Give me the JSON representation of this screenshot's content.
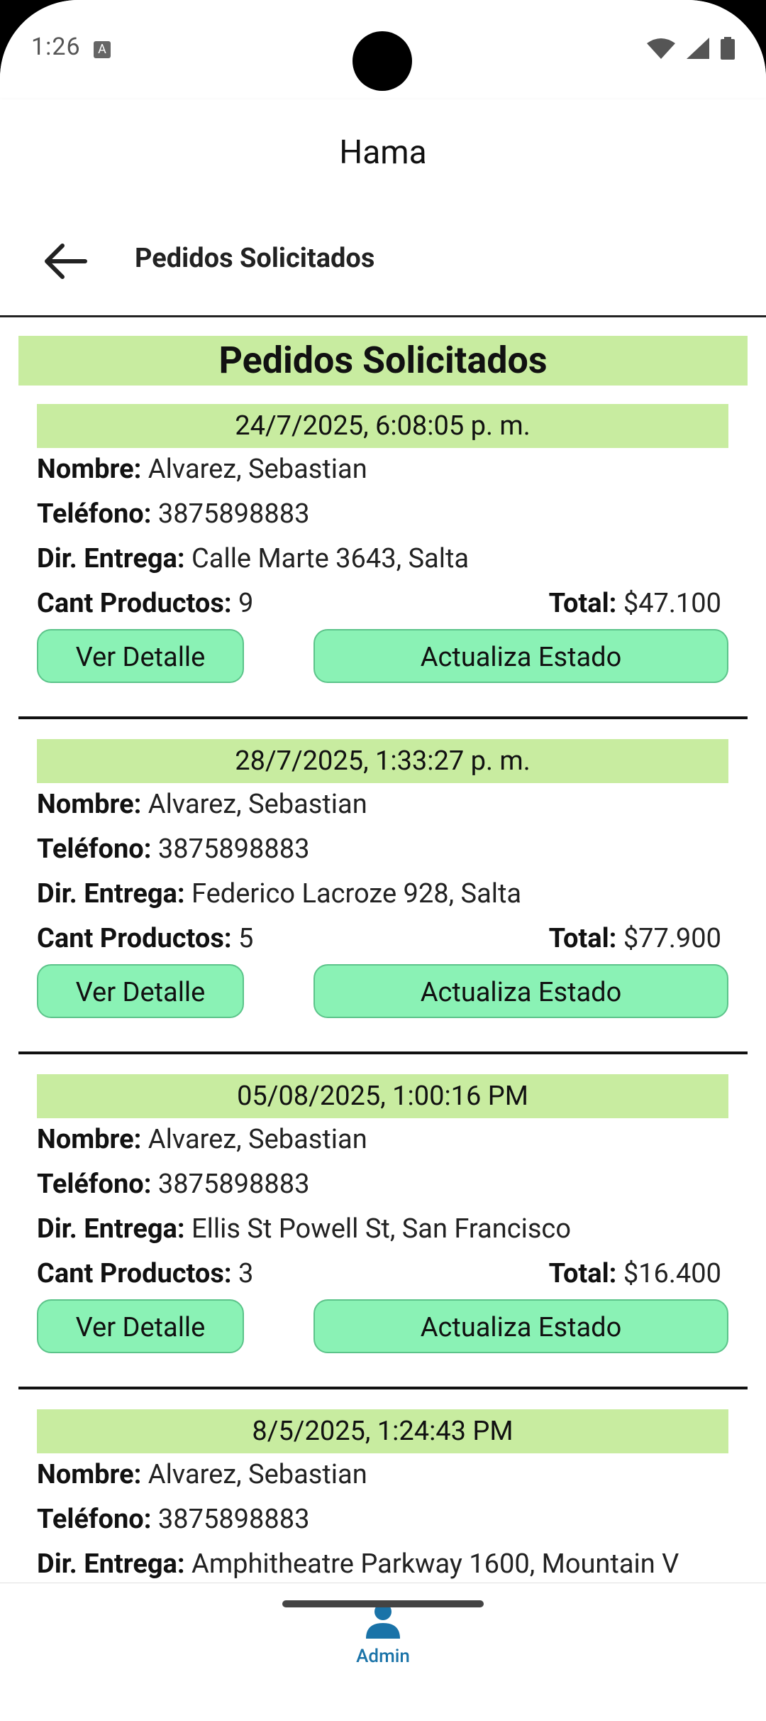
{
  "status_bar": {
    "time": "1:26"
  },
  "app": {
    "title": "Hama"
  },
  "toolbar": {
    "title": "Pedidos Solicitados"
  },
  "main": {
    "heading": "Pedidos Solicitados",
    "labels": {
      "nombre": "Nombre:",
      "telefono": "Teléfono:",
      "direccion": "Dir. Entrega:",
      "cant": "Cant Productos:",
      "total": "Total:",
      "ver_detalle": "Ver Detalle",
      "actualiza_estado": "Actualiza Estado"
    },
    "orders": [
      {
        "date": "24/7/2025, 6:08:05 p. m.",
        "nombre": "Alvarez, Sebastian",
        "telefono": "3875898883",
        "direccion": "Calle Marte 3643, Salta",
        "cant": "9",
        "total": "$47.100"
      },
      {
        "date": "28/7/2025, 1:33:27 p. m.",
        "nombre": "Alvarez, Sebastian",
        "telefono": "3875898883",
        "direccion": "Federico Lacroze 928, Salta",
        "cant": "5",
        "total": "$77.900"
      },
      {
        "date": "05/08/2025, 1:00:16 PM",
        "nombre": "Alvarez, Sebastian",
        "telefono": "3875898883",
        "direccion": "Ellis St Powell St, San Francisco",
        "cant": "3",
        "total": "$16.400"
      },
      {
        "date": "8/5/2025, 1:24:43 PM",
        "nombre": "Alvarez, Sebastian",
        "telefono": "3875898883",
        "direccion": "Amphitheatre Parkway 1600, Mountain V"
      }
    ]
  },
  "bottom_nav": {
    "items": [
      {
        "label": "Admin",
        "icon": "person-icon"
      }
    ]
  },
  "colors": {
    "accent_green": "#c8eca0",
    "button_green": "#8af2b5",
    "nav_active": "#1a73a8"
  }
}
